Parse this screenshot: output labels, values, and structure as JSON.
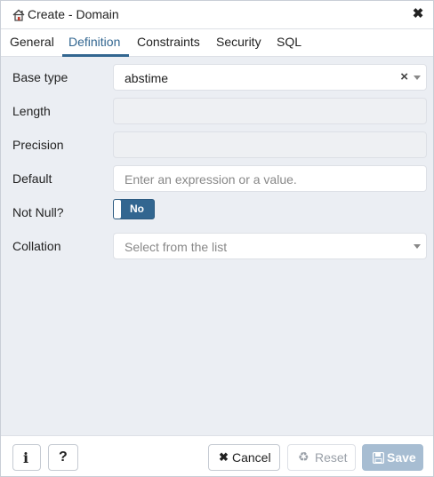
{
  "dialog": {
    "title": "Create - Domain",
    "icon": "domain-house-icon",
    "close_icon": "close-icon"
  },
  "tabs": [
    {
      "label": "General",
      "active": false
    },
    {
      "label": "Definition",
      "active": true
    },
    {
      "label": "Constraints",
      "active": false
    },
    {
      "label": "Security",
      "active": false
    },
    {
      "label": "SQL",
      "active": false
    }
  ],
  "form": {
    "base_type": {
      "label": "Base type",
      "value": "abstime"
    },
    "length": {
      "label": "Length",
      "value": ""
    },
    "precision": {
      "label": "Precision",
      "value": ""
    },
    "default": {
      "label": "Default",
      "placeholder": "Enter an expression or a value."
    },
    "not_null": {
      "label": "Not Null?",
      "value": "No"
    },
    "collation": {
      "label": "Collation",
      "placeholder": "Select from the list"
    }
  },
  "footer": {
    "info_icon": "info-icon",
    "help_icon": "question-icon",
    "cancel_label": "Cancel",
    "reset_label": "Reset",
    "save_label": "Save"
  },
  "colors": {
    "accent": "#326690",
    "panel_bg": "#ebeef3",
    "save_disabled": "#a7bdd2"
  }
}
